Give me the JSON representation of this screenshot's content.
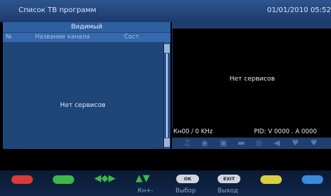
{
  "header": {
    "title": "Список ТВ программ",
    "datetime": "01/01/2010 05:52"
  },
  "channel_list": {
    "title": "Видимый",
    "columns": [
      "№",
      "Название канала",
      "Сост."
    ],
    "empty_text": "Нет сервисов"
  },
  "preview": {
    "empty_text": "Нет сервисов",
    "frequency": "Кн00 / 0 KHz",
    "pid": "PID: V 0000 . A 0000"
  },
  "status_icons": [
    "music-note-icon",
    "lock-icon",
    "cart-icon",
    "car-icon",
    "globe-icon",
    "skip-icon",
    "heart-icon",
    "heart-icon"
  ],
  "keybar": {
    "colors": {
      "red": "#d93a3a",
      "green": "#3bb84a",
      "yellow": "#d8d040",
      "blue": "#3a8be0"
    },
    "ok_label": "OK",
    "exit_label": "EXIT",
    "chan_label": "Кн+-",
    "select_label": "Выбор",
    "exit_action_label": "Выход"
  }
}
